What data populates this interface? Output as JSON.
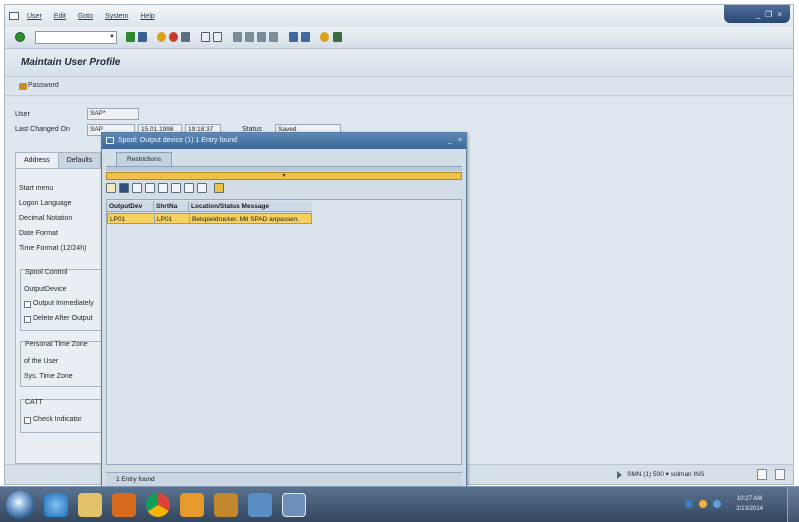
{
  "menu": {
    "items": [
      "User",
      "Edit",
      "Goto",
      "System",
      "Help"
    ]
  },
  "window_controls": [
    "_",
    "❐",
    "×"
  ],
  "page_title": "Maintain User Profile",
  "app_toolbar": {
    "password_label": "Password"
  },
  "form": {
    "user_label": "User",
    "user_value": "SAP*",
    "last_changed_label": "Last Changed On",
    "last_changed_by": "SAP",
    "last_changed_date": "15.01.1998",
    "last_changed_time": "19:18:37",
    "status_label": "Status",
    "status_value": "Saved",
    "tabs": [
      "Address",
      "Defaults"
    ],
    "defaults_fields": [
      "Start menu",
      "Logon Language",
      "Decimal Notation",
      "Date Format",
      "Time Format (12/24h)"
    ],
    "spool_group": {
      "title": "Spool Control",
      "output_device_label": "OutputDevice",
      "output_immediately_label": "Output Immediately",
      "delete_after_output_label": "Delete After Output"
    },
    "timezone_group": {
      "title": "Personal Time Zone",
      "of_user_label": "of the User",
      "sys_zone_label": "Sys. Time Zone"
    },
    "catt_group": {
      "title": "CATT",
      "check_indicator_label": "Check Indicator"
    }
  },
  "dialog": {
    "title": "Spool: Output device (1)   1 Entry found",
    "controls": [
      "_",
      "×"
    ],
    "tab_label": "Restrictions",
    "collapse_glyph": "▾",
    "columns": [
      "OutputDev",
      "ShrtNa",
      "Location/Status Message"
    ],
    "rows": [
      {
        "output_dev": "LP01",
        "short_name": "LP01",
        "location": "Beispieldrucker. Mit SPAD anpassen."
      }
    ],
    "status_text": "1 Entry found"
  },
  "status_bar": {
    "system_info": "SMN (1) 500 ▾  solman  INS"
  },
  "taskbar": {
    "time": "10:27 AM",
    "date": "2/13/2014"
  },
  "colors": {
    "sap_background": "#d9e2ea",
    "dialog_title": "#3d6a9b",
    "selection_row": "#f6d15d",
    "taskbar": "#33465e"
  }
}
